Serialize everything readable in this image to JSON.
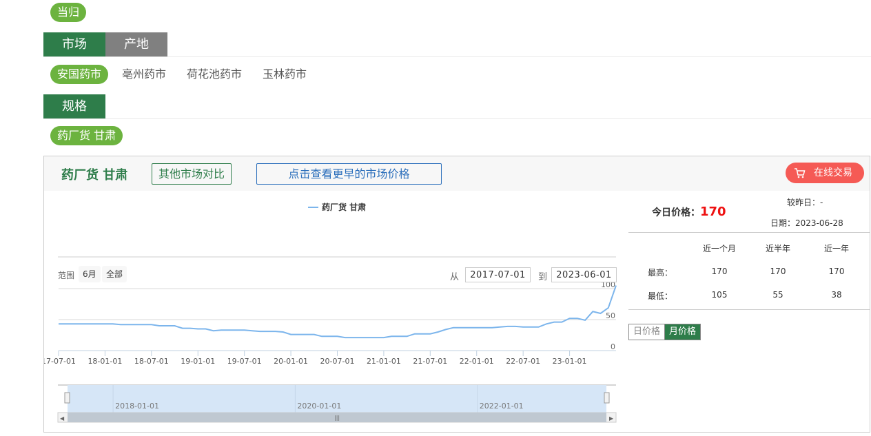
{
  "category_pill": "当归",
  "filter_tabs": [
    {
      "label": "市场",
      "active": true
    },
    {
      "label": "产地",
      "active": false
    }
  ],
  "markets": [
    {
      "label": "安国药市",
      "active": true
    },
    {
      "label": "亳州药市",
      "active": false
    },
    {
      "label": "荷花池药市",
      "active": false
    },
    {
      "label": "玉林药市",
      "active": false
    }
  ],
  "spec_tab": "规格",
  "spec_pill": "药厂货 甘肃",
  "panel": {
    "title": "药厂货 甘肃",
    "compare_button": "其他市场对比",
    "earlier_button": "点击查看更早的市场价格",
    "trade_button": "在线交易",
    "trade_icon": "cart-icon",
    "range_label": "范围",
    "range_buttons": [
      "6月",
      "全部"
    ],
    "from_label": "从",
    "to_label": "到",
    "from_date": "2017-07-01",
    "to_date": "2023-06-01"
  },
  "price_info": {
    "today_label": "今日价格：",
    "today_value": "170",
    "vs_yesterday": "较昨日：-",
    "date": "日期：2023-06-28",
    "columns": [
      "近一个月",
      "近半年",
      "近一年"
    ],
    "rows": [
      {
        "label": "最高：",
        "values": [
          "170",
          "170",
          "170"
        ]
      },
      {
        "label": "最低：",
        "values": [
          "105",
          "55",
          "38"
        ]
      }
    ],
    "period_buttons": [
      {
        "label": "日价格",
        "active": false
      },
      {
        "label": "月价格",
        "active": true
      }
    ]
  },
  "chart_data": {
    "type": "line",
    "title": "",
    "legend": [
      "药厂货 甘肃"
    ],
    "legend_position": "top-center",
    "xlabel": "",
    "ylabel": "",
    "ylim": [
      0,
      100
    ],
    "y_ticks": [
      "0",
      "50",
      "100"
    ],
    "y_axis_side": "right",
    "x_tick_labels": [
      "17-07-01",
      "18-01-01",
      "18-07-01",
      "19-01-01",
      "19-07-01",
      "20-01-01",
      "20-07-01",
      "21-01-01",
      "21-07-01",
      "22-01-01",
      "22-07-01",
      "23-01-01"
    ],
    "x_start": "2017-07",
    "x_interval": "month",
    "grid": true,
    "series": [
      {
        "name": "药厂货 甘肃",
        "color": "#7cb5ec",
        "values": [
          43,
          43,
          43,
          43,
          43,
          43,
          43,
          43,
          42,
          42,
          42,
          42,
          42,
          40,
          40,
          40,
          36,
          36,
          35,
          35,
          32,
          33,
          33,
          33,
          33,
          32,
          31,
          31,
          31,
          30,
          26,
          26,
          26,
          26,
          23,
          23,
          23,
          21,
          21,
          21,
          21,
          21,
          21,
          23,
          23,
          23,
          27,
          27,
          27,
          30,
          34,
          37,
          37,
          37,
          37,
          37,
          37,
          38,
          39,
          39,
          38,
          38,
          38,
          43,
          46,
          46,
          52,
          52,
          49,
          63,
          60,
          69,
          105
        ]
      }
    ],
    "navigator": {
      "labels": [
        "2018-01-01",
        "2020-01-01",
        "2022-01-01"
      ],
      "range": [
        "2017-07-01",
        "2023-06-01"
      ]
    }
  }
}
